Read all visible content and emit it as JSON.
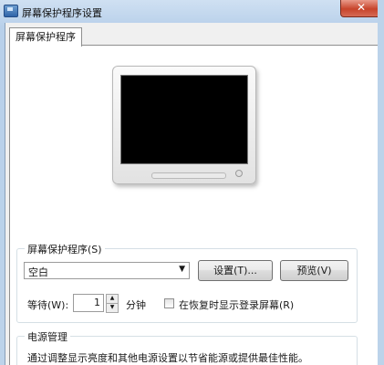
{
  "window": {
    "title": "屏幕保护程序设置",
    "close_label": "✕"
  },
  "tabs": [
    {
      "label": "屏幕保护程序",
      "selected": true
    }
  ],
  "screensaver": {
    "group_label": "屏幕保护程序(S)",
    "selected": "空白",
    "settings_label": "设置(T)...",
    "preview_label": "预览(V)",
    "wait_label": "等待(W):",
    "wait_value": "1",
    "wait_unit": "分钟",
    "resume_logon_label": "在恢复时显示登录屏幕(R)",
    "resume_logon_checked": false
  },
  "power": {
    "group_label": "电源管理",
    "description": "通过调整显示亮度和其他电源设置以节省能源或提供最佳性能。"
  }
}
